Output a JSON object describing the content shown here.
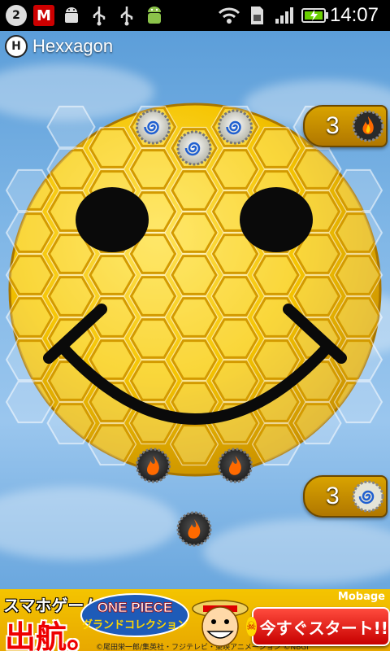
{
  "status_bar": {
    "notification_count": "2",
    "icons": [
      "notification-count-icon",
      "mcafee-icon",
      "android-debug-icon",
      "usb-icon",
      "usb-icon",
      "android-market-icon",
      "wifi-icon",
      "sim-icon",
      "signal-icon",
      "battery-charging-icon"
    ],
    "time": "14:07"
  },
  "app": {
    "title": "Hexxagon",
    "logo_icon": "hexxagon-logo-icon"
  },
  "board": {
    "theme": "smiley-face",
    "colors": {
      "face": "#f5c400",
      "cell_edge": "#d39a00",
      "outside_cell": "#ffffff",
      "fire_piece": "#3a3a3a",
      "spiral_piece": "#dcdcd0"
    },
    "fire_pieces": [
      [
        3,
        8
      ],
      [
        4,
        9
      ],
      [
        5,
        8
      ]
    ],
    "spiral_pieces": [
      [
        3,
        0
      ],
      [
        4,
        0
      ],
      [
        5,
        0
      ]
    ],
    "piece_icons": {
      "fire": "fire-piece-icon",
      "spiral": "spiral-piece-icon"
    }
  },
  "scores": {
    "fire": {
      "count": "3",
      "icon": "fire-piece-icon"
    },
    "spiral": {
      "count": "3",
      "icon": "spiral-piece-icon"
    }
  },
  "ad": {
    "line1": "スマホゲーム",
    "line2": "出航。",
    "title": "ONE PIECE",
    "subtitle": "グランドコレクション",
    "caption": "©尾田栄一郎/集英社・フジテレビ・東映アニメーション ©NBGI",
    "brand": "Mobage",
    "button": "今すぐスタート!!!",
    "button_icon": "skull-icon",
    "character_icon": "luffy-face-icon"
  }
}
